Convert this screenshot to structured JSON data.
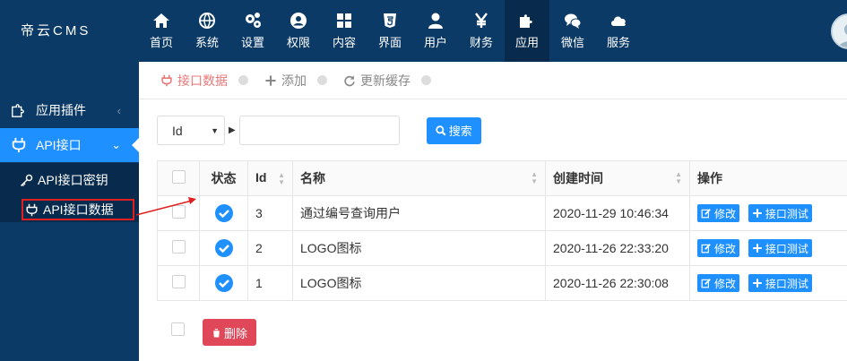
{
  "brand": "帝云CMS",
  "nav": [
    {
      "label": "首页",
      "icon": "home-icon"
    },
    {
      "label": "系统",
      "icon": "globe-icon"
    },
    {
      "label": "设置",
      "icon": "cogs-icon"
    },
    {
      "label": "权限",
      "icon": "user-circle-icon"
    },
    {
      "label": "内容",
      "icon": "grid-icon"
    },
    {
      "label": "界面",
      "icon": "html5-icon"
    },
    {
      "label": "用户",
      "icon": "user-icon"
    },
    {
      "label": "财务",
      "icon": "yen-icon"
    },
    {
      "label": "应用",
      "icon": "puzzle-icon",
      "active": true
    },
    {
      "label": "微信",
      "icon": "wechat-icon"
    },
    {
      "label": "服务",
      "icon": "cloud-icon"
    }
  ],
  "sidebar": {
    "groups": [
      {
        "label": "应用插件",
        "icon": "puzzle-icon"
      },
      {
        "label": "API接口",
        "icon": "plug-icon",
        "active": true
      }
    ],
    "sub_items": [
      {
        "label": "API接口密钥",
        "icon": "key-icon"
      },
      {
        "label": "API接口数据",
        "icon": "plug-icon",
        "active": true
      }
    ]
  },
  "tabs": [
    {
      "label": "接口数据",
      "icon": "plug-icon",
      "active": true
    },
    {
      "label": "添加",
      "icon": "plus-icon"
    },
    {
      "label": "更新缓存",
      "icon": "refresh-icon"
    }
  ],
  "filter": {
    "field": "Id",
    "value": "",
    "search_label": "搜索"
  },
  "table": {
    "columns": [
      "状态",
      "Id",
      "名称",
      "创建时间",
      "操作"
    ],
    "rows": [
      {
        "id": "3",
        "name": "通过编号查询用户",
        "created": "2020-11-29 10:46:34"
      },
      {
        "id": "2",
        "name": "LOGO图标",
        "created": "2020-11-26 22:33:20"
      },
      {
        "id": "1",
        "name": "LOGO图标",
        "created": "2020-11-26 22:30:08"
      }
    ],
    "edit_label": "修改",
    "test_label": "接口测试"
  },
  "delete_label": "删除",
  "colors": {
    "header_bg": "#0b3a66",
    "accent": "#1e90ff",
    "danger": "#e0485a",
    "active_tab": "#e87878",
    "highlight_box": "#e02020"
  }
}
